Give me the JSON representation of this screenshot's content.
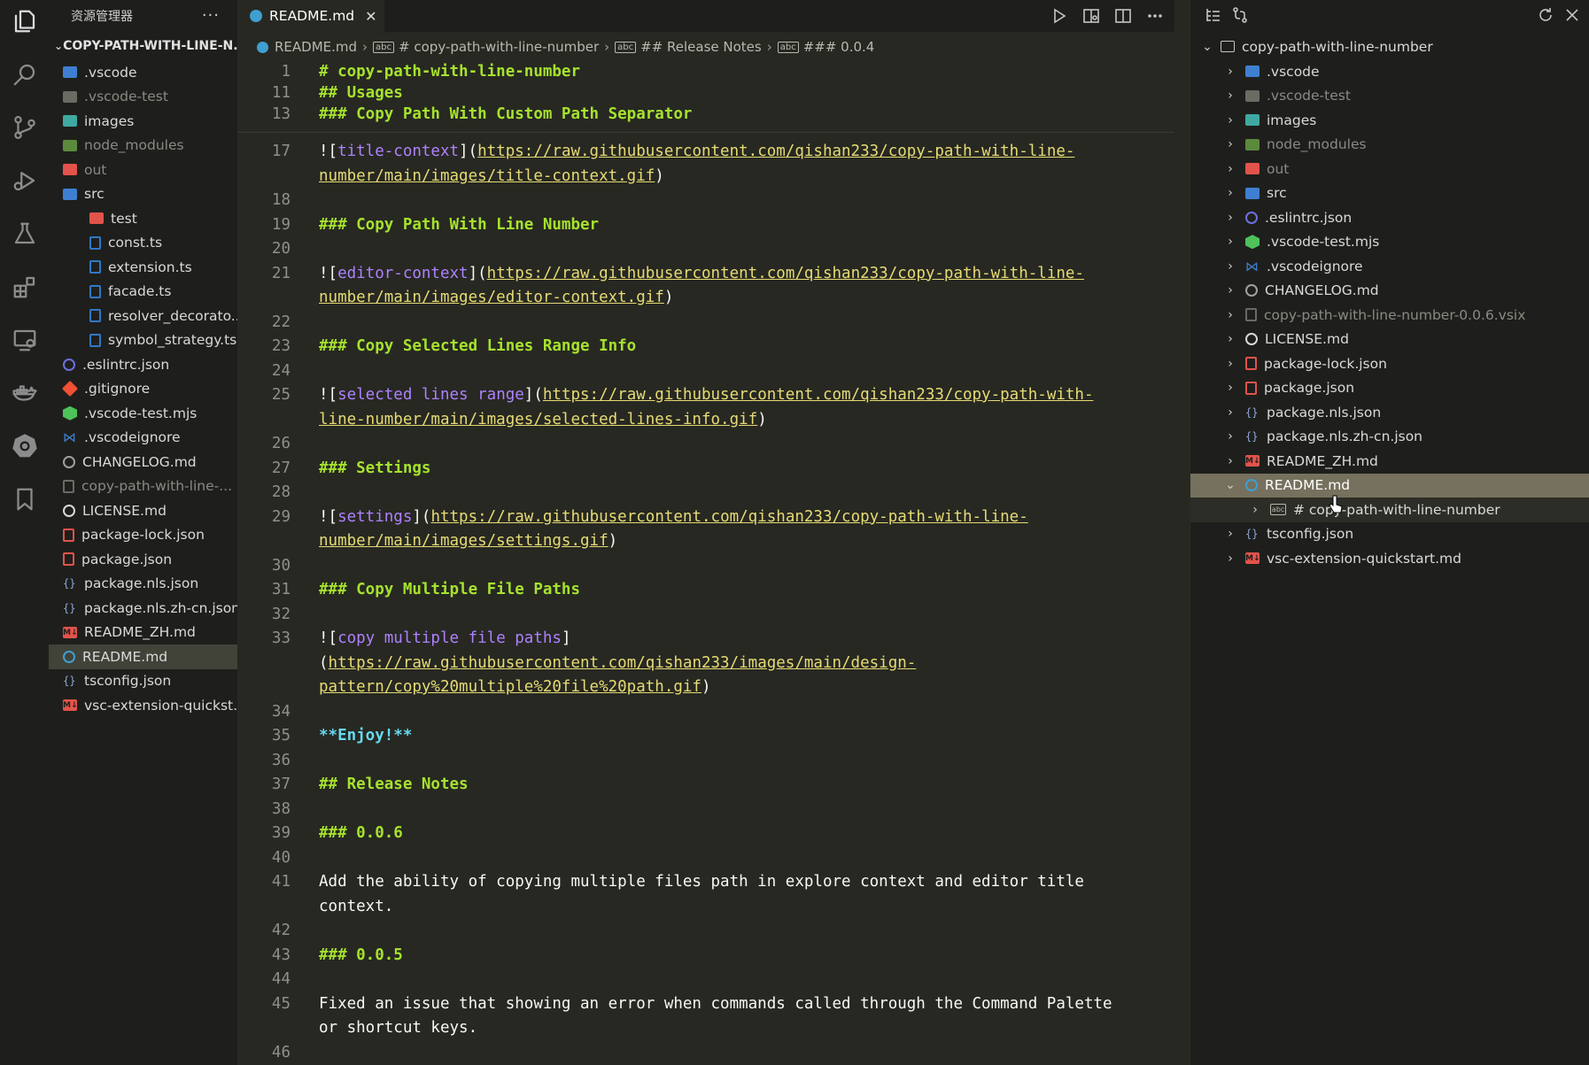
{
  "sidebar": {
    "title": "资源管理器",
    "more": "···",
    "section": "COPY-PATH-WITH-LINE-N...",
    "items": [
      {
        "label": ".vscode",
        "icon": "folder-vscode-icon",
        "color": "#3f7fd1",
        "indent": 0,
        "dim": false
      },
      {
        "label": ".vscode-test",
        "icon": "folder-icon",
        "color": "#6b6b63",
        "indent": 0,
        "dim": true
      },
      {
        "label": "images",
        "icon": "folder-images-icon",
        "color": "#3fa9a1",
        "indent": 0,
        "dim": false
      },
      {
        "label": "node_modules",
        "icon": "folder-node-icon",
        "color": "#5b8a3c",
        "indent": 0,
        "dim": true
      },
      {
        "label": "out",
        "icon": "folder-out-icon",
        "color": "#e2534b",
        "indent": 0,
        "dim": true
      },
      {
        "label": "src",
        "icon": "folder-src-icon",
        "color": "#3f7fd1",
        "indent": 0,
        "dim": false
      },
      {
        "label": "test",
        "icon": "folder-test-icon",
        "color": "#e2534b",
        "indent": 1,
        "dim": false
      },
      {
        "label": "const.ts",
        "icon": "typescript-icon",
        "color": "#3178c6",
        "indent": 1,
        "dim": false
      },
      {
        "label": "extension.ts",
        "icon": "typescript-icon",
        "color": "#3178c6",
        "indent": 1,
        "dim": false
      },
      {
        "label": "facade.ts",
        "icon": "typescript-icon",
        "color": "#3178c6",
        "indent": 1,
        "dim": false
      },
      {
        "label": "resolver_decorato...",
        "icon": "typescript-icon",
        "color": "#3178c6",
        "indent": 1,
        "dim": false
      },
      {
        "label": "symbol_strategy.ts",
        "icon": "typescript-icon",
        "color": "#3178c6",
        "indent": 1,
        "dim": false
      },
      {
        "label": ".eslintrc.json",
        "icon": "eslint-icon",
        "color": "#6c6fe0",
        "indent": 0,
        "dim": false
      },
      {
        "label": ".gitignore",
        "icon": "git-icon",
        "color": "#f05033",
        "indent": 0,
        "dim": false
      },
      {
        "label": ".vscode-test.mjs",
        "icon": "hexagon-icon",
        "color": "#4ec15a",
        "indent": 0,
        "dim": false
      },
      {
        "label": ".vscodeignore",
        "icon": "vscode-icon",
        "color": "#3f7fd1",
        "indent": 0,
        "dim": false
      },
      {
        "label": "CHANGELOG.md",
        "icon": "history-icon",
        "color": "#a0a0a0",
        "indent": 0,
        "dim": false
      },
      {
        "label": "copy-path-with-line-...",
        "icon": "file-icon",
        "color": "#6b6b63",
        "indent": 0,
        "dim": true
      },
      {
        "label": "LICENSE.md",
        "icon": "license-icon",
        "color": "#d9d9d9",
        "indent": 0,
        "dim": false
      },
      {
        "label": "package-lock.json",
        "icon": "npm-lock-icon",
        "color": "#e2534b",
        "indent": 0,
        "dim": false
      },
      {
        "label": "package.json",
        "icon": "npm-icon",
        "color": "#e2534b",
        "indent": 0,
        "dim": false
      },
      {
        "label": "package.nls.json",
        "icon": "json-braces-icon",
        "color": "#8fa6d6",
        "indent": 0,
        "dim": false
      },
      {
        "label": "package.nls.zh-cn.json",
        "icon": "json-braces-icon",
        "color": "#8fa6d6",
        "indent": 0,
        "dim": false
      },
      {
        "label": "README_ZH.md",
        "icon": "markdown-icon",
        "color": "#e2534b",
        "indent": 0,
        "dim": false
      },
      {
        "label": "README.md",
        "icon": "info-icon",
        "color": "#3f9fd1",
        "indent": 0,
        "dim": false,
        "selected": true
      },
      {
        "label": "tsconfig.json",
        "icon": "json-braces-icon",
        "color": "#8fa6d6",
        "indent": 0,
        "dim": false
      },
      {
        "label": "vsc-extension-quickst...",
        "icon": "markdown-icon",
        "color": "#e2534b",
        "indent": 0,
        "dim": false
      }
    ]
  },
  "tab": {
    "label": "README.md",
    "close": "✕"
  },
  "breadcrumb": [
    "README.md",
    "# copy-path-with-line-number",
    "## Release Notes",
    "### 0.0.4"
  ],
  "sticky_lines": [
    {
      "n": "1",
      "text": "# copy-path-with-line-number"
    },
    {
      "n": "11",
      "text": "## Usages"
    },
    {
      "n": "13",
      "text": "### Copy Path With Custom Path Separator"
    }
  ],
  "code_lines": [
    {
      "n": "17",
      "parts": [
        [
          "pn",
          "!["
        ],
        [
          "lk",
          "title-context"
        ],
        [
          "pn",
          "]("
        ],
        [
          "url",
          "https://raw.githubusercontent.com/qishan233/copy-path-with-line-"
        ]
      ]
    },
    {
      "n": "",
      "parts": [
        [
          "url",
          "number/main/images/title-context.gif"
        ],
        [
          "pn",
          ")"
        ]
      ]
    },
    {
      "n": "18",
      "parts": []
    },
    {
      "n": "19",
      "parts": [
        [
          "hd",
          "### Copy Path With Line Number"
        ]
      ]
    },
    {
      "n": "20",
      "parts": []
    },
    {
      "n": "21",
      "parts": [
        [
          "pn",
          "!["
        ],
        [
          "lk",
          "editor-context"
        ],
        [
          "pn",
          "]("
        ],
        [
          "url",
          "https://raw.githubusercontent.com/qishan233/copy-path-with-line-"
        ]
      ]
    },
    {
      "n": "",
      "parts": [
        [
          "url",
          "number/main/images/editor-context.gif"
        ],
        [
          "pn",
          ")"
        ]
      ]
    },
    {
      "n": "22",
      "parts": []
    },
    {
      "n": "23",
      "parts": [
        [
          "hd",
          "### Copy Selected Lines Range Info"
        ]
      ]
    },
    {
      "n": "24",
      "parts": []
    },
    {
      "n": "25",
      "parts": [
        [
          "pn",
          "!["
        ],
        [
          "lk",
          "selected lines range"
        ],
        [
          "pn",
          "]("
        ],
        [
          "url",
          "https://raw.githubusercontent.com/qishan233/copy-path-with-"
        ]
      ]
    },
    {
      "n": "",
      "parts": [
        [
          "url",
          "line-number/main/images/selected-lines-info.gif"
        ],
        [
          "pn",
          ")"
        ]
      ]
    },
    {
      "n": "26",
      "parts": []
    },
    {
      "n": "27",
      "parts": [
        [
          "hd",
          "### Settings"
        ]
      ]
    },
    {
      "n": "28",
      "parts": []
    },
    {
      "n": "29",
      "parts": [
        [
          "pn",
          "!["
        ],
        [
          "lk",
          "settings"
        ],
        [
          "pn",
          "]("
        ],
        [
          "url",
          "https://raw.githubusercontent.com/qishan233/copy-path-with-line-"
        ]
      ]
    },
    {
      "n": "",
      "parts": [
        [
          "url",
          "number/main/images/settings.gif"
        ],
        [
          "pn",
          ")"
        ]
      ]
    },
    {
      "n": "30",
      "parts": []
    },
    {
      "n": "31",
      "parts": [
        [
          "hd",
          "### Copy Multiple File Paths"
        ]
      ]
    },
    {
      "n": "32",
      "parts": []
    },
    {
      "n": "33",
      "parts": [
        [
          "pn",
          "!["
        ],
        [
          "lk",
          "copy multiple file paths"
        ],
        [
          "pn",
          "]"
        ]
      ]
    },
    {
      "n": "",
      "parts": [
        [
          "pn",
          "("
        ],
        [
          "url",
          "https://raw.githubusercontent.com/qishan233/images/main/design-"
        ]
      ]
    },
    {
      "n": "",
      "parts": [
        [
          "url",
          "pattern/copy%20multiple%20file%20path.gif"
        ],
        [
          "pn",
          ")"
        ]
      ]
    },
    {
      "n": "34",
      "parts": []
    },
    {
      "n": "35",
      "parts": [
        [
          "bold",
          "**Enjoy!**"
        ]
      ]
    },
    {
      "n": "36",
      "parts": []
    },
    {
      "n": "37",
      "parts": [
        [
          "hd",
          "## Release Notes"
        ]
      ]
    },
    {
      "n": "38",
      "parts": []
    },
    {
      "n": "39",
      "parts": [
        [
          "hd",
          "### 0.0.6"
        ]
      ]
    },
    {
      "n": "40",
      "parts": []
    },
    {
      "n": "41",
      "parts": [
        [
          "pn",
          "Add the ability of copying multiple files path in explore context and editor title"
        ]
      ]
    },
    {
      "n": "",
      "parts": [
        [
          "pn",
          "context."
        ]
      ]
    },
    {
      "n": "42",
      "parts": []
    },
    {
      "n": "43",
      "parts": [
        [
          "hd",
          "### 0.0.5"
        ]
      ]
    },
    {
      "n": "44",
      "parts": []
    },
    {
      "n": "45",
      "parts": [
        [
          "pn",
          "Fixed an issue that showing an error when commands called through the Command Palette"
        ]
      ]
    },
    {
      "n": "",
      "parts": [
        [
          "pn",
          "or shortcut keys."
        ]
      ]
    },
    {
      "n": "46",
      "parts": []
    }
  ],
  "outline": {
    "root": "copy-path-with-line-number",
    "items": [
      {
        "label": ".vscode",
        "icon": "folder-vscode-icon",
        "color": "#3f7fd1",
        "dim": false
      },
      {
        "label": ".vscode-test",
        "icon": "folder-icon",
        "color": "#6b6b63",
        "dim": true
      },
      {
        "label": "images",
        "icon": "folder-images-icon",
        "color": "#3fa9a1",
        "dim": false
      },
      {
        "label": "node_modules",
        "icon": "folder-node-icon",
        "color": "#5b8a3c",
        "dim": true
      },
      {
        "label": "out",
        "icon": "folder-out-icon",
        "color": "#e2534b",
        "dim": true
      },
      {
        "label": "src",
        "icon": "folder-src-icon",
        "color": "#3f7fd1",
        "dim": false
      },
      {
        "label": ".eslintrc.json",
        "icon": "eslint-icon",
        "color": "#6c6fe0",
        "dim": false
      },
      {
        "label": ".vscode-test.mjs",
        "icon": "hexagon-icon",
        "color": "#4ec15a",
        "dim": false
      },
      {
        "label": ".vscodeignore",
        "icon": "vscode-icon",
        "color": "#3f7fd1",
        "dim": false
      },
      {
        "label": "CHANGELOG.md",
        "icon": "history-icon",
        "color": "#a0a0a0",
        "dim": false
      },
      {
        "label": "copy-path-with-line-number-0.0.6.vsix",
        "icon": "file-icon",
        "color": "#6b6b63",
        "dim": true
      },
      {
        "label": "LICENSE.md",
        "icon": "license-icon",
        "color": "#d9d9d9",
        "dim": false
      },
      {
        "label": "package-lock.json",
        "icon": "npm-lock-icon",
        "color": "#e2534b",
        "dim": false
      },
      {
        "label": "package.json",
        "icon": "npm-icon",
        "color": "#e2534b",
        "dim": false
      },
      {
        "label": "package.nls.json",
        "icon": "json-braces-icon",
        "color": "#8fa6d6",
        "dim": false
      },
      {
        "label": "package.nls.zh-cn.json",
        "icon": "json-braces-icon",
        "color": "#8fa6d6",
        "dim": false
      },
      {
        "label": "README_ZH.md",
        "icon": "markdown-icon",
        "color": "#e2534b",
        "dim": false
      },
      {
        "label": "README.md",
        "icon": "info-icon",
        "color": "#3f9fd1",
        "dim": false,
        "expanded": true,
        "selected": true
      },
      {
        "label": "# copy-path-with-line-number",
        "icon": "string-symbol-icon",
        "color": "#b8b8b0",
        "dim": false,
        "child": true
      },
      {
        "label": "tsconfig.json",
        "icon": "json-braces-icon",
        "color": "#8fa6d6",
        "dim": false
      },
      {
        "label": "vsc-extension-quickstart.md",
        "icon": "markdown-icon",
        "color": "#e2534b",
        "dim": false
      }
    ]
  }
}
